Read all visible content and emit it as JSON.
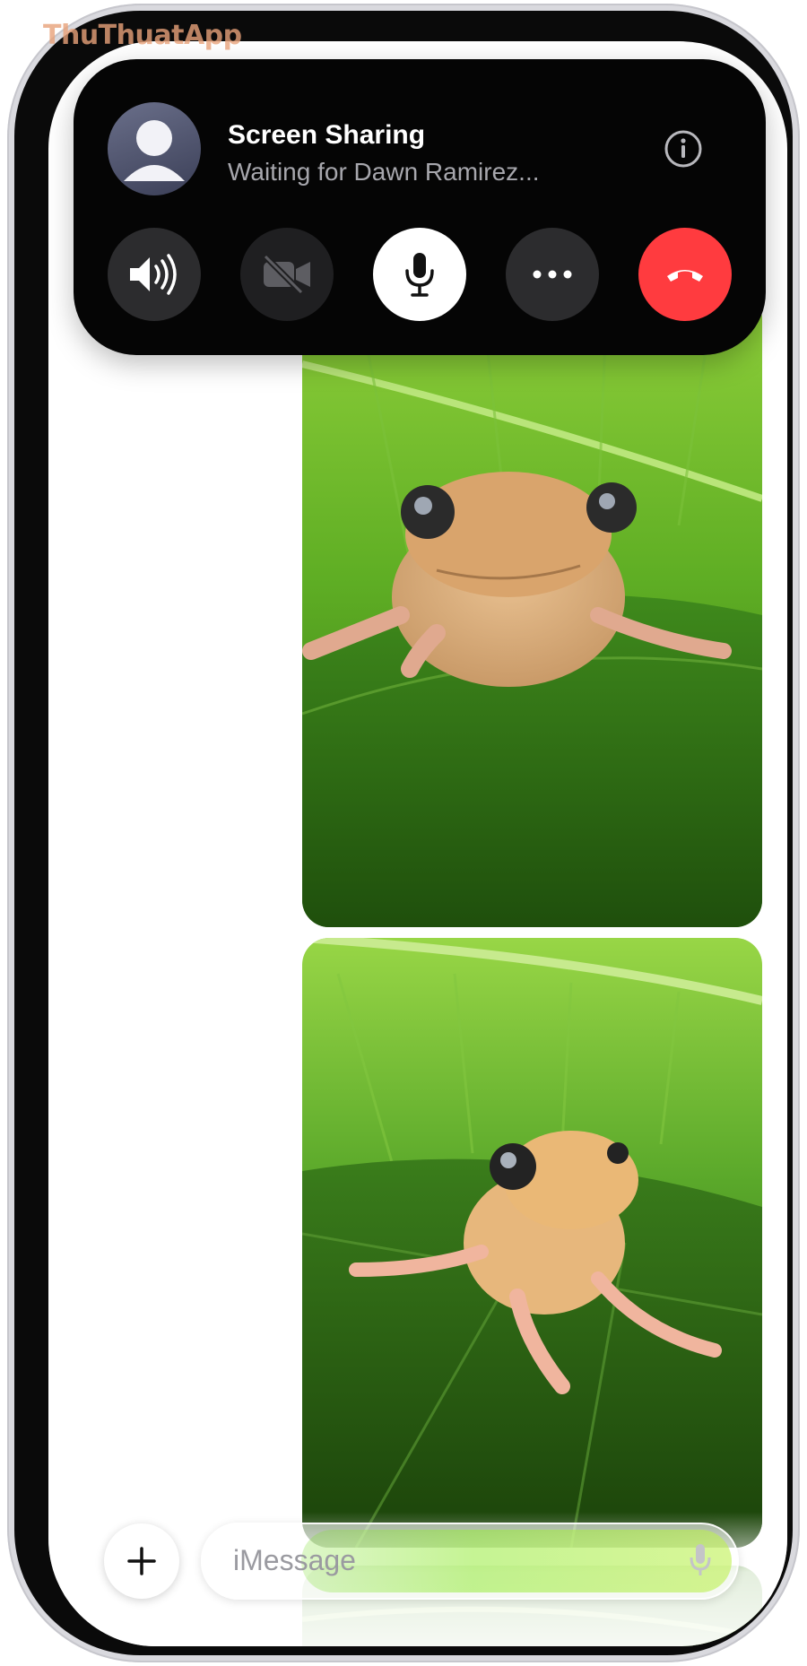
{
  "watermark": "ThuThuatApp",
  "call": {
    "title": "Screen Sharing",
    "subtitle": "Waiting for Dawn Ramirez...",
    "controls": [
      "speaker",
      "camera-off",
      "microphone",
      "more",
      "end-call"
    ],
    "colors": {
      "banner": "#050505",
      "control": "#2c2c2e",
      "mic_active": "#ffffff",
      "end_call": "#ff3b3f"
    }
  },
  "compose": {
    "placeholder": "iMessage"
  },
  "icons": {
    "avatar": "person-icon",
    "info": "info-icon",
    "speaker": "speaker-icon",
    "camera": "video-off-icon",
    "mic": "microphone-icon",
    "more": "ellipsis-icon",
    "end": "end-call-icon",
    "add": "plus-icon"
  }
}
